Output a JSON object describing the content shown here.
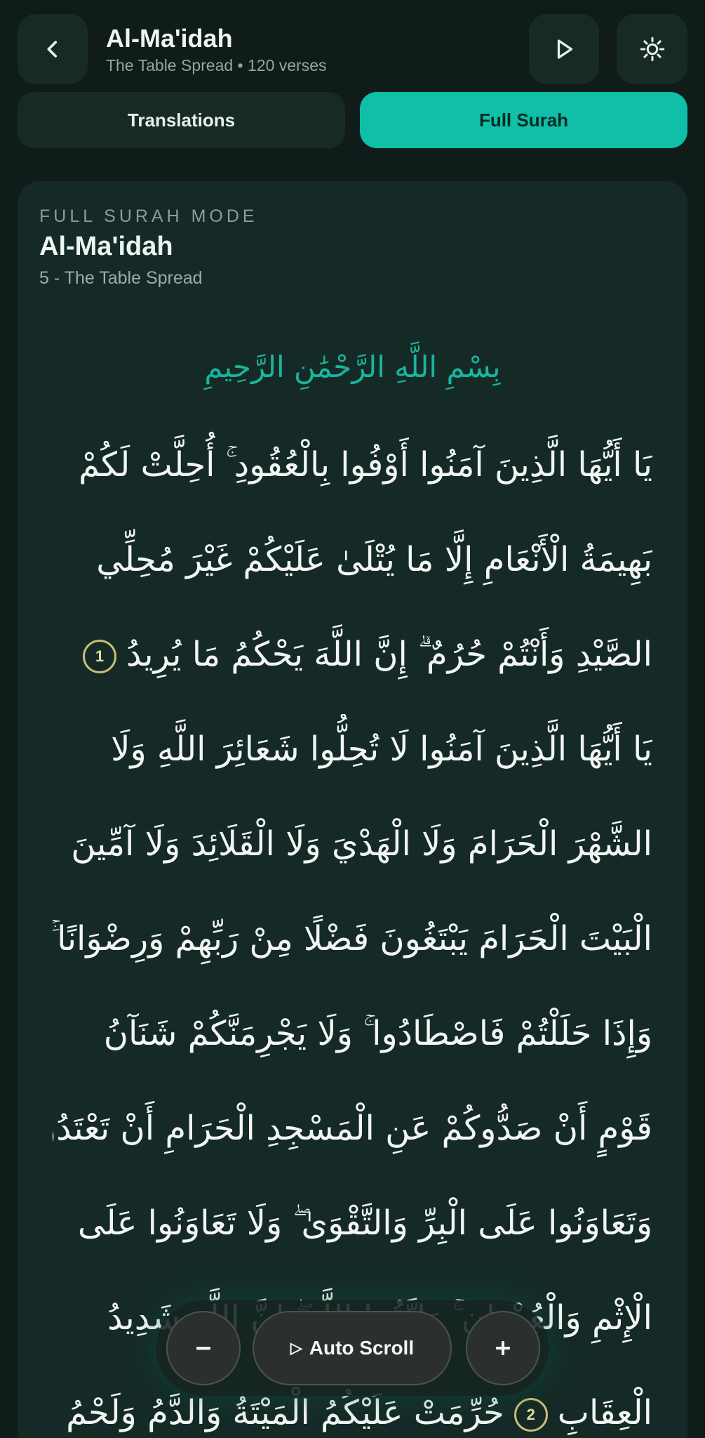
{
  "header": {
    "title": "Al-Ma'idah",
    "subtitle": "The Table Spread • 120 verses",
    "back_icon": "chevron-left-icon",
    "play_icon": "play-icon",
    "theme_icon": "sun-icon"
  },
  "tabs": [
    {
      "label": "Translations",
      "active": false
    },
    {
      "label": "Full Surah",
      "active": true
    }
  ],
  "card": {
    "mode_label": "FULL SURAH MODE",
    "title": "Al-Ma'idah",
    "subtitle": "5 - The Table Spread",
    "bismillah": "بِسْمِ اللَّهِ الرَّحْمَٰنِ الرَّحِيمِ",
    "lines": [
      {
        "text": "يَا أَيُّهَا الَّذِينَ آمَنُوا أَوْفُوا بِالْعُقُودِ ۚ أُحِلَّتْ لَكُمْ"
      },
      {
        "text": "بَهِيمَةُ الْأَنْعَامِ إِلَّا مَا يُتْلَىٰ عَلَيْكُمْ غَيْرَ مُحِلِّي"
      },
      {
        "text": "الصَّيْدِ وَأَنْتُمْ حُرُمٌ ۗ إِنَّ اللَّهَ يَحْكُمُ مَا يُرِيدُ",
        "ayah_end": "1"
      },
      {
        "text": "يَا أَيُّهَا الَّذِينَ آمَنُوا لَا تُحِلُّوا شَعَائِرَ اللَّهِ وَلَا"
      },
      {
        "text": "الشَّهْرَ الْحَرَامَ وَلَا الْهَدْيَ وَلَا الْقَلَائِدَ وَلَا آمِّينَ"
      },
      {
        "text": "الْبَيْتَ الْحَرَامَ يَبْتَغُونَ فَضْلًا مِنْ رَبِّهِمْ وَرِضْوَانًا ۚ"
      },
      {
        "text": "وَإِذَا حَلَلْتُمْ فَاصْطَادُوا ۚ وَلَا يَجْرِمَنَّكُمْ شَنَآنُ"
      },
      {
        "text": "قَوْمٍ أَنْ صَدُّوكُمْ عَنِ الْمَسْجِدِ الْحَرَامِ أَنْ تَعْتَدُوا ۘ"
      },
      {
        "text": "وَتَعَاوَنُوا عَلَى الْبِرِّ وَالتَّقْوَىٰ ۖ وَلَا تَعَاوَنُوا عَلَى"
      },
      {
        "text": "الْإِثْمِ وَالْعُدْوَانِ ۚ وَاتَّقُوا اللَّهَ ۖ إِنَّ اللَّهَ شَدِيدُ"
      },
      {
        "text": "الْعِقَابِ",
        "ayah_end": "2",
        "after": "حُرِّمَتْ عَلَيْكُمُ الْمَيْتَةُ وَالدَّمُ وَلَحْمُ"
      }
    ]
  },
  "controls": {
    "minus_label": "−",
    "auto_icon": "▷",
    "auto_label": "Auto Scroll",
    "plus_label": "+"
  }
}
